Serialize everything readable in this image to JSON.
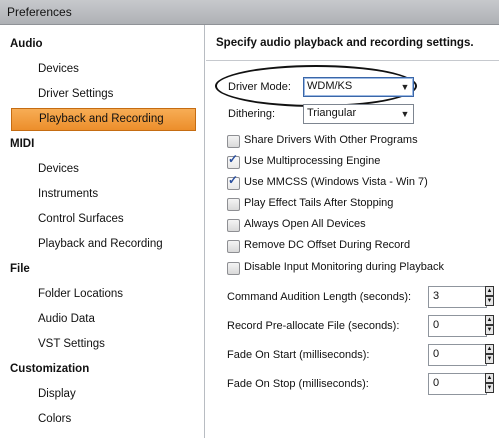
{
  "window": {
    "title": "Preferences"
  },
  "sidebar": {
    "categories": [
      "Audio",
      "MIDI",
      "File",
      "Customization"
    ],
    "audio_items": [
      "Devices",
      "Driver Settings",
      "Playback and Recording"
    ],
    "midi_items": [
      "Devices",
      "Instruments",
      "Control Surfaces",
      "Playback and Recording"
    ],
    "file_items": [
      "Folder Locations",
      "Audio Data",
      "VST Settings"
    ],
    "customization_items": [
      "Display",
      "Colors"
    ],
    "selected": "Playback and Recording"
  },
  "main": {
    "header": "Specify audio playback and recording settings.",
    "driver_mode": {
      "label": "Driver Mode:",
      "value": "WDM/KS"
    },
    "dithering": {
      "label": "Dithering:",
      "value": "Triangular"
    },
    "checkboxes": [
      {
        "label": "Share Drivers With Other Programs",
        "checked": false
      },
      {
        "label": "Use Multiprocessing Engine",
        "checked": true
      },
      {
        "label": "Use MMCSS (Windows Vista - Win 7)",
        "checked": true
      },
      {
        "label": "Play Effect Tails After Stopping",
        "checked": false
      },
      {
        "label": "Always Open All Devices",
        "checked": false
      },
      {
        "label": "Remove DC Offset During Record",
        "checked": false
      },
      {
        "label": "Disable Input Monitoring during Playback",
        "checked": false
      }
    ],
    "spinners": [
      {
        "label": "Command Audition Length (seconds):",
        "value": "3"
      },
      {
        "label": "Record Pre-allocate File (seconds):",
        "value": "0"
      },
      {
        "label": "Fade On Start  (milliseconds):",
        "value": "0"
      },
      {
        "label": "Fade On Stop  (milliseconds):",
        "value": "0"
      }
    ],
    "check_glyph": "✓",
    "arrow_down": "▼",
    "arrow_up": "▲"
  }
}
